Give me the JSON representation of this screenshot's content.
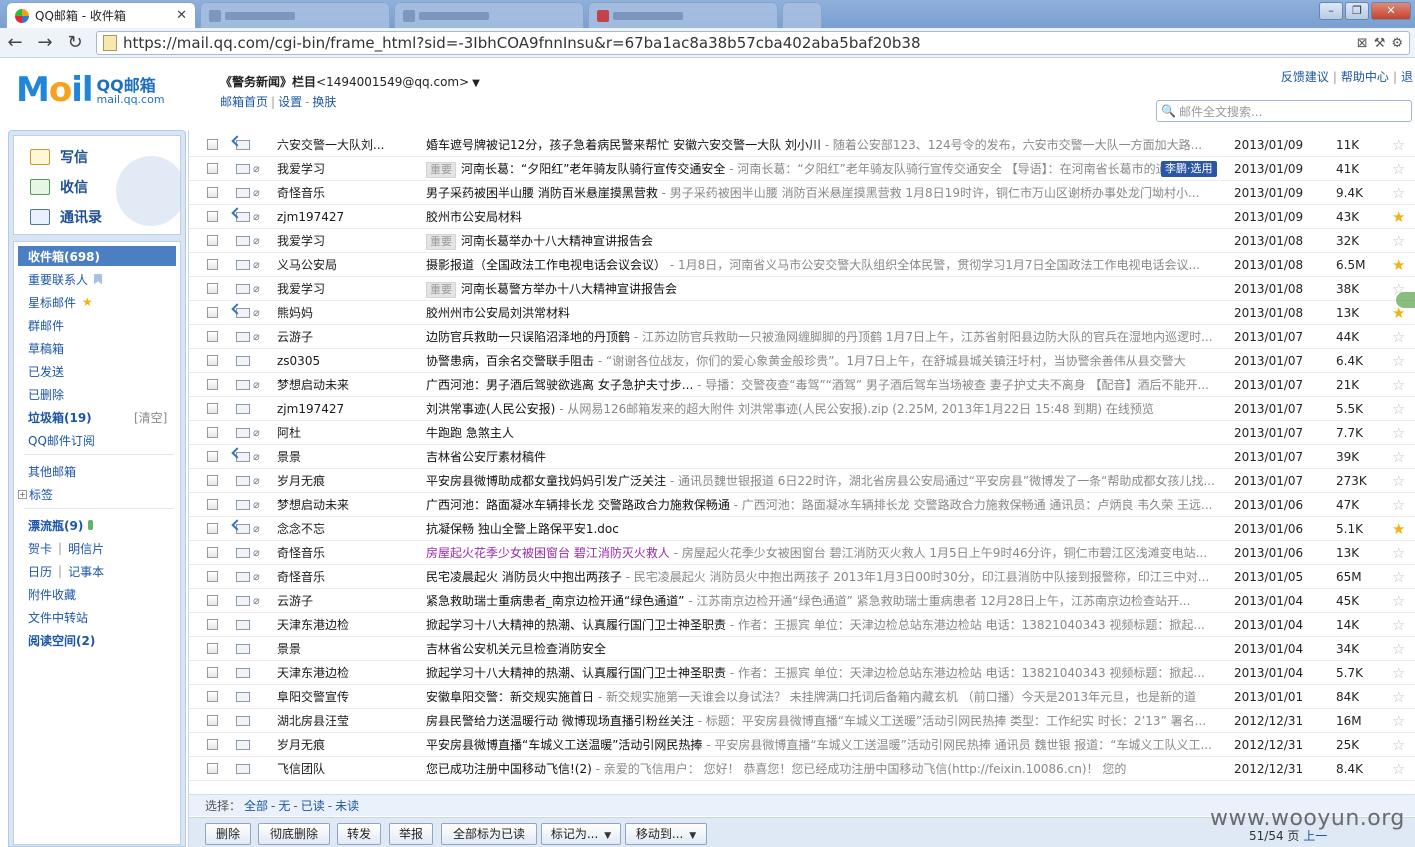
{
  "browser": {
    "tab_title": "QQ邮箱 - 收件箱",
    "url": "https://mail.qq.com/cgi-bin/frame_html?sid=-3IbhCOA9fnnInsu&r=67ba1ac8a38b57cba402aba5baf20b38"
  },
  "header": {
    "logo_main": "M",
    "logo_o": "o",
    "logo_rest": "il",
    "logo_cn": "QQ邮箱",
    "logo_domain": "mail.qq.com",
    "account_name": "《警务新闻》栏目",
    "account_email": "<1494001549@qq.com>",
    "links": [
      "邮箱首页",
      "设置",
      "换肤"
    ],
    "top_links": [
      "反馈建议",
      "帮助中心",
      "退"
    ],
    "search_placeholder": "邮件全文搜索..."
  },
  "sidebar": {
    "quick": [
      "写信",
      "收信",
      "通讯录"
    ],
    "inbox_label": "收件箱(698)",
    "vip_contacts": "重要联系人",
    "starred": "星标邮件",
    "group_mail": "群邮件",
    "drafts": "草稿箱",
    "sent": "已发送",
    "deleted": "已删除",
    "spam": "垃圾箱(19)",
    "spam_clear": "[清空]",
    "subscriptions": "QQ邮件订阅",
    "other_mail": "其他邮箱",
    "tags": "标签",
    "bottle": "漂流瓶(9)",
    "cards": "贺卡",
    "postcards": "明信片",
    "calendar": "日历",
    "notes": "记事本",
    "attachments": "附件收藏",
    "file_transfer": "文件中转站",
    "reading_space": "阅读空间(2)"
  },
  "mail_list": {
    "tooltip": "李鹏·选用",
    "rows": [
      {
        "from": "六安交警一大队刘...",
        "badge": "",
        "title": "婚车遮号牌被记12分，孩子急着病民警来帮忙  安徽六安交警一大队  刘小川",
        "preview": " - 随着公安部123、124号令的发布，六安市交警一大队一方面加大路...",
        "date": "2013/01/09",
        "size": "11K",
        "starred": false,
        "reply": true,
        "attach": false,
        "purple": false
      },
      {
        "from": "我爱学习",
        "badge": "重要",
        "title": "河南长葛：“夕阳红”老年骑友队骑行宣传交通安全",
        "preview": " - 河南长葛：“夕阳红”老年骑友队骑行宣传交通安全 【导语】：在河南省长葛市的道",
        "date": "2013/01/09",
        "size": "41K",
        "starred": false,
        "reply": false,
        "attach": true,
        "purple": false
      },
      {
        "from": "奇怪音乐",
        "badge": "",
        "title": "男子采药被困半山腰 消防百米悬崖摸黑营救",
        "preview": " - 男子采药被困半山腰 消防百米悬崖摸黑营救  1月8日19时许，铜仁市万山区谢桥办事处龙门坳村小...",
        "date": "2013/01/09",
        "size": "9.4K",
        "starred": false,
        "reply": false,
        "attach": true,
        "purple": false
      },
      {
        "from": "zjm197427",
        "badge": "",
        "title": "胶州市公安局材料",
        "preview": "",
        "date": "2013/01/09",
        "size": "43K",
        "starred": true,
        "reply": true,
        "attach": true,
        "purple": false
      },
      {
        "from": "我爱学习",
        "badge": "重要",
        "title": "河南长葛举办十八大精神宣讲报告会",
        "preview": "",
        "date": "2013/01/08",
        "size": "32K",
        "starred": false,
        "reply": false,
        "attach": true,
        "purple": false
      },
      {
        "from": "义马公安局",
        "badge": "",
        "title": "摄影报道（全国政法工作电视电话会议会议）",
        "preview": " - 1月8日，河南省义马市公安交警大队组织全体民警，贯彻学习1月7日全国政法工作电视电话会议...",
        "date": "2013/01/08",
        "size": "6.5M",
        "starred": true,
        "reply": false,
        "attach": true,
        "purple": false
      },
      {
        "from": "我爱学习",
        "badge": "重要",
        "title": "河南长葛警方举办十八大精神宣讲报告会",
        "preview": "",
        "date": "2013/01/08",
        "size": "38K",
        "starred": false,
        "reply": false,
        "attach": true,
        "purple": false
      },
      {
        "from": "熊妈妈",
        "badge": "",
        "title": "胶州州市公安局刘洪常材料",
        "preview": "",
        "date": "2013/01/08",
        "size": "13K",
        "starred": true,
        "reply": true,
        "attach": true,
        "purple": false
      },
      {
        "from": "云游子",
        "badge": "",
        "title": "边防官兵救助一只误陷沼泽地的丹顶鹤",
        "preview": " - 江苏边防官兵救助一只被渔网缠脚脚的丹顶鹤  1月7日上午，江苏省射阳县边防大队的官兵在湿地内巡逻时...",
        "date": "2013/01/07",
        "size": "44K",
        "starred": false,
        "reply": false,
        "attach": true,
        "purple": false
      },
      {
        "from": "zs0305",
        "badge": "",
        "title": "协警患病，百余名交警联手阻击",
        "preview": " - “谢谢各位战友，你们的爱心象黄金般珍贵”。1月7日上午，在舒城县城关镇汪圩村，当协警余善伟从县交警大",
        "date": "2013/01/07",
        "size": "6.4K",
        "starred": false,
        "reply": false,
        "attach": false,
        "purple": false
      },
      {
        "from": "梦想启动未来",
        "badge": "",
        "title": "广西河池：男子酒后驾驶欲逃离  女子急护夫寸步...",
        "preview": " - 导播：交警夜查“毒驾”“酒驾” 男子酒后驾车当场被查 妻子护丈夫不离身 【配音】酒后不能开...",
        "date": "2013/01/07",
        "size": "21K",
        "starred": false,
        "reply": false,
        "attach": true,
        "purple": false
      },
      {
        "from": "zjm197427",
        "badge": "",
        "title": "刘洪常事迹(人民公安报)",
        "preview": " - 从网易126邮箱发来的超大附件  刘洪常事迹(人民公安报).zip (2.25M, 2013年1月22日 15:48 到期) 在线预览",
        "date": "2013/01/07",
        "size": "5.5K",
        "starred": false,
        "reply": false,
        "attach": false,
        "purple": false
      },
      {
        "from": "阿杜",
        "badge": "",
        "title": "牛跑跑  急煞主人",
        "preview": "",
        "date": "2013/01/07",
        "size": "7.7K",
        "starred": false,
        "reply": false,
        "attach": true,
        "purple": false
      },
      {
        "from": "景景",
        "badge": "",
        "title": "吉林省公安厅素材稿件",
        "preview": "",
        "date": "2013/01/07",
        "size": "39K",
        "starred": false,
        "reply": true,
        "attach": true,
        "purple": false
      },
      {
        "from": "岁月无痕",
        "badge": "",
        "title": "平安房县微博助成都女童找妈妈引发广泛关注",
        "preview": " - 通讯员魏世银报道 6日22时许，湖北省房县公安局通过“平安房县”微博发了一条“帮助成都女孩儿找...",
        "date": "2013/01/07",
        "size": "273K",
        "starred": false,
        "reply": false,
        "attach": true,
        "purple": false
      },
      {
        "from": "梦想启动未来",
        "badge": "",
        "title": "广西河池：路面凝冰车辆排长龙  交警路政合力施救保畅通",
        "preview": " - 广西河池：路面凝冰车辆排长龙 交警路政合力施救保畅通 通讯员：卢炳良 韦久荣 王远...",
        "date": "2013/01/06",
        "size": "47K",
        "starred": false,
        "reply": false,
        "attach": true,
        "purple": false
      },
      {
        "from": "念念不忘",
        "badge": "",
        "title": "抗凝保畅 独山全警上路保平安1.doc",
        "preview": "",
        "date": "2013/01/06",
        "size": "5.1K",
        "starred": true,
        "reply": true,
        "attach": true,
        "purple": false
      },
      {
        "from": "奇怪音乐",
        "badge": "",
        "title": "房屋起火花季少女被困窗台 碧江消防灭火救人",
        "preview": " - 房屋起火花季少女被困窗台 碧江消防灭火救人 1月5日上午9时46分许，铜仁市碧江区浅滩变电站...",
        "date": "2013/01/06",
        "size": "13K",
        "starred": false,
        "reply": false,
        "attach": true,
        "purple": true
      },
      {
        "from": "奇怪音乐",
        "badge": "",
        "title": "民宅凌晨起火 消防员火中抱出两孩子",
        "preview": " - 民宅凌晨起火 消防员火中抱出两孩子  2013年1月3日00时30分，印江县消防中队接到报警称，印江三中对...",
        "date": "2013/01/05",
        "size": "65M",
        "starred": false,
        "reply": false,
        "attach": true,
        "purple": false
      },
      {
        "from": "云游子",
        "badge": "",
        "title": "紧急救助瑞士重病患者_南京边检开通“绿色通道”",
        "preview": " - 江苏南京边检开通“绿色通道” 紧急救助瑞士重病患者  12月28日上午，江苏南京边检查站开...",
        "date": "2013/01/04",
        "size": "45K",
        "starred": false,
        "reply": false,
        "attach": true,
        "purple": false
      },
      {
        "from": "天津东港边检",
        "badge": "",
        "title": "掀起学习十八大精神的热潮、认真履行国门卫士神圣职责",
        "preview": " - 作者：王振宾 单位：天津边检总站东港边检站 电话：13821040343 视频标题：掀起...",
        "date": "2013/01/04",
        "size": "14K",
        "starred": false,
        "reply": false,
        "attach": false,
        "purple": false
      },
      {
        "from": "景景",
        "badge": "",
        "title": "吉林省公安机关元旦检查消防安全",
        "preview": "",
        "date": "2013/01/04",
        "size": "34K",
        "starred": false,
        "reply": false,
        "attach": false,
        "purple": false
      },
      {
        "from": "天津东港边检",
        "badge": "",
        "title": "掀起学习十八大精神的热潮、认真履行国门卫士神圣职责",
        "preview": " - 作者：王振宾 单位：天津边检总站东港边检站 电话：13821040343 视频标题：掀起...",
        "date": "2013/01/04",
        "size": "5.7K",
        "starred": false,
        "reply": false,
        "attach": false,
        "purple": false
      },
      {
        "from": "阜阳交警宣传",
        "badge": "",
        "title": "安徽阜阳交警：新交规实施首日",
        "preview": " - 新交规实施第一天谁会以身试法？ 未挂牌满口托词后备箱内藏玄机  （前口播）今天是2013年元旦，也是新的道",
        "date": "2013/01/01",
        "size": "84K",
        "starred": false,
        "reply": false,
        "attach": false,
        "purple": false
      },
      {
        "from": "湖北房县汪莹",
        "badge": "",
        "title": "房县民警给力送温暖行动  微博现场直播引粉丝关注",
        "preview": " - 标题：平安房县微博直播“车城义工送暖”活动引网民热捧 类型：工作纪实 时长：2’13” 署名...",
        "date": "2012/12/31",
        "size": "16M",
        "starred": false,
        "reply": false,
        "attach": false,
        "purple": false
      },
      {
        "from": "岁月无痕",
        "badge": "",
        "title": "平安房县微博直播“车城义工送温暖”活动引网民热捧",
        "preview": " - 平安房县微博直播“车城义工送温暖”活动引网民热捧  通讯员 魏世银 报道：“车城义工队义工...",
        "date": "2012/12/31",
        "size": "25K",
        "starred": false,
        "reply": false,
        "attach": false,
        "purple": false
      },
      {
        "from": "飞信团队",
        "badge": "",
        "title": "您已成功注册中国移动飞信!(2)",
        "preview": " -            亲爱的飞信用户：  您好！  恭喜您！您已经成功注册中国移动飞信(http://feixin.10086.cn)！ 您的",
        "date": "2012/12/31",
        "size": "8.4K",
        "starred": false,
        "reply": false,
        "attach": false,
        "purple": false
      }
    ]
  },
  "select_bar": {
    "label": "选择：",
    "options": [
      "全部",
      "无",
      "已读",
      "未读"
    ]
  },
  "actions": {
    "delete": "删除",
    "delete_forever": "彻底删除",
    "forward": "转发",
    "report": "举报",
    "mark_all_read": "全部标为已读",
    "mark_as": "标记为...",
    "move_to": "移动到..."
  },
  "pager": {
    "text": "51/54 页",
    "prev": "上一"
  },
  "watermark": "www.wooyun.org"
}
